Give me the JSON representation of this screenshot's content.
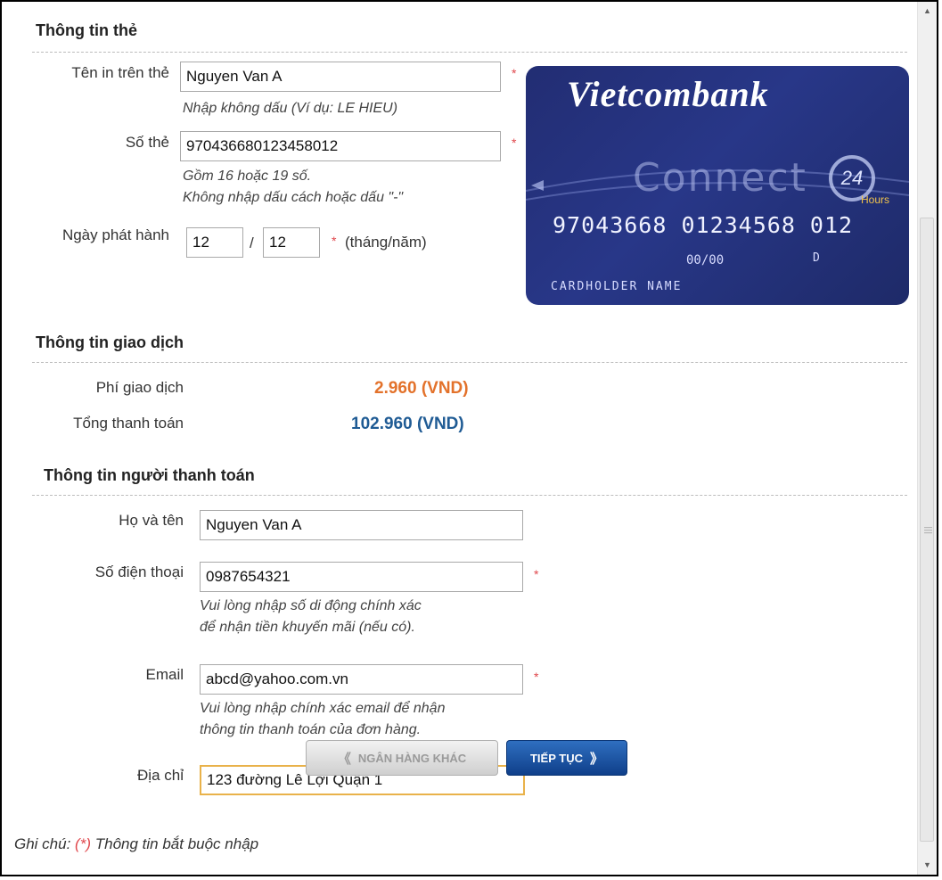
{
  "card_section": {
    "title": "Thông tin thẻ",
    "name_label": "Tên in trên thẻ",
    "name_value": "Nguyen Van A",
    "name_hint": "Nhập không dấu (Ví dụ: LE HIEU)",
    "number_label": "Số thẻ",
    "number_value": "970436680123458012",
    "number_hint_1": "Gồm 16 hoặc 19 số.",
    "number_hint_2": "Không nhập dấu cách hoặc dấu \"-\"",
    "issue_label": "Ngày phát hành",
    "issue_month": "12",
    "issue_sep": "/",
    "issue_year": "12",
    "issue_format": "(tháng/năm)",
    "required_mark": "*"
  },
  "card_image": {
    "brand": "Vietcombank",
    "product": "Connect",
    "badge": "24",
    "badge_sub": "Hours",
    "number": "97043668 01234568 012",
    "valid_thru": "00/00",
    "class_code": "D",
    "holder": "CARDHOLDER NAME"
  },
  "transaction": {
    "title": "Thông tin giao dịch",
    "fee_label": "Phí giao dịch",
    "fee_value": "2.960 (VND)",
    "total_label": "Tổng thanh toán",
    "total_value": "102.960 (VND)"
  },
  "payer": {
    "title": "Thông tin người thanh toán",
    "fullname_label": "Họ và tên",
    "fullname_value": "Nguyen Van A",
    "phone_label": "Số điện thoại",
    "phone_value": "0987654321",
    "phone_hint_1": "Vui lòng nhập số di động chính xác",
    "phone_hint_2": "để nhận tiền khuyến mãi (nếu có).",
    "email_label": "Email",
    "email_value": "abcd@yahoo.com.vn",
    "email_hint_1": "Vui lòng nhập chính xác email để nhận",
    "email_hint_2": "thông tin thanh toán của đơn hàng.",
    "address_label": "Địa chỉ",
    "address_value": "123 đường Lê Lợi Quận 1"
  },
  "buttons": {
    "other_bank": "NGÂN HÀNG KHÁC",
    "continue": "TIẾP TỤC"
  },
  "note": {
    "prefix": "Ghi chú:",
    "star": "(*)",
    "text": "Thông tin bắt buộc nhập"
  },
  "colors": {
    "fee": "#e3722b",
    "total": "#1f5b94",
    "required": "#e0474c"
  }
}
